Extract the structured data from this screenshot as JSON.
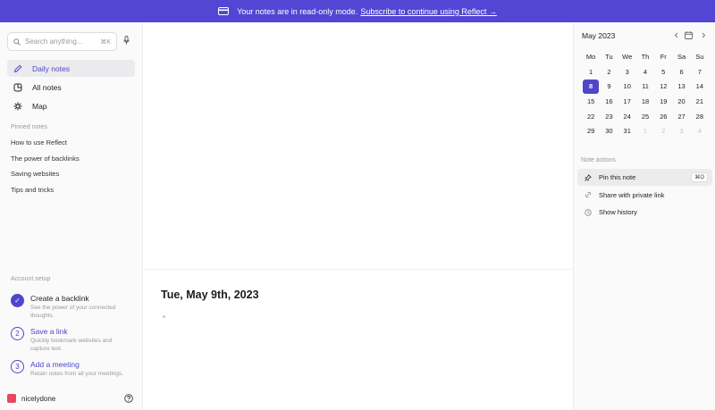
{
  "banner": {
    "text": "Your notes are in read-only mode.",
    "link": "Subscribe to continue using Reflect →",
    "background": "#5346d4"
  },
  "search": {
    "placeholder": "Search anything...",
    "shortcut": "⌘K"
  },
  "nav": [
    {
      "label": "Daily notes",
      "icon": "pencil-icon",
      "active": true
    },
    {
      "label": "All notes",
      "icon": "notes-icon",
      "active": false
    },
    {
      "label": "Map",
      "icon": "map-icon",
      "active": false
    }
  ],
  "pinned": {
    "heading": "Pinned notes",
    "items": [
      "How to use Reflect",
      "The power of backlinks",
      "Saving websites",
      "Tips and tricks"
    ]
  },
  "setup": {
    "heading": "Account setup",
    "steps": [
      {
        "marker": "✓",
        "title": "Create a backlink",
        "desc": "See the power of your connected thoughts.",
        "done": true
      },
      {
        "marker": "2",
        "title": "Save a link",
        "desc": "Quickly bookmark websites and capture text.",
        "done": false
      },
      {
        "marker": "3",
        "title": "Add a meeting",
        "desc": "Retain notes from all your meetings.",
        "done": false
      }
    ]
  },
  "user": {
    "name": "nicelydone",
    "color": "#e8475f"
  },
  "main": {
    "date_title": "Tue, May 9th, 2023"
  },
  "calendar": {
    "month": "May 2023",
    "weekdays": [
      "Mo",
      "Tu",
      "We",
      "Th",
      "Fr",
      "Sa",
      "Su"
    ],
    "weeks": [
      [
        "1",
        "2",
        "3",
        "4",
        "5",
        "6",
        "7"
      ],
      [
        "8",
        "9",
        "10",
        "11",
        "12",
        "13",
        "14"
      ],
      [
        "15",
        "16",
        "17",
        "18",
        "19",
        "20",
        "21"
      ],
      [
        "22",
        "23",
        "24",
        "25",
        "26",
        "27",
        "28"
      ],
      [
        "29",
        "30",
        "31",
        "1",
        "2",
        "3",
        "4"
      ]
    ],
    "selected": "8",
    "accent": "#4f46c8"
  },
  "note_actions": {
    "heading": "Note actions",
    "items": [
      {
        "label": "Pin this note",
        "icon": "pin-icon",
        "shortcut": "⌘O"
      },
      {
        "label": "Share with private link",
        "icon": "link-icon",
        "shortcut": ""
      },
      {
        "label": "Show history",
        "icon": "clock-icon",
        "shortcut": ""
      }
    ]
  }
}
